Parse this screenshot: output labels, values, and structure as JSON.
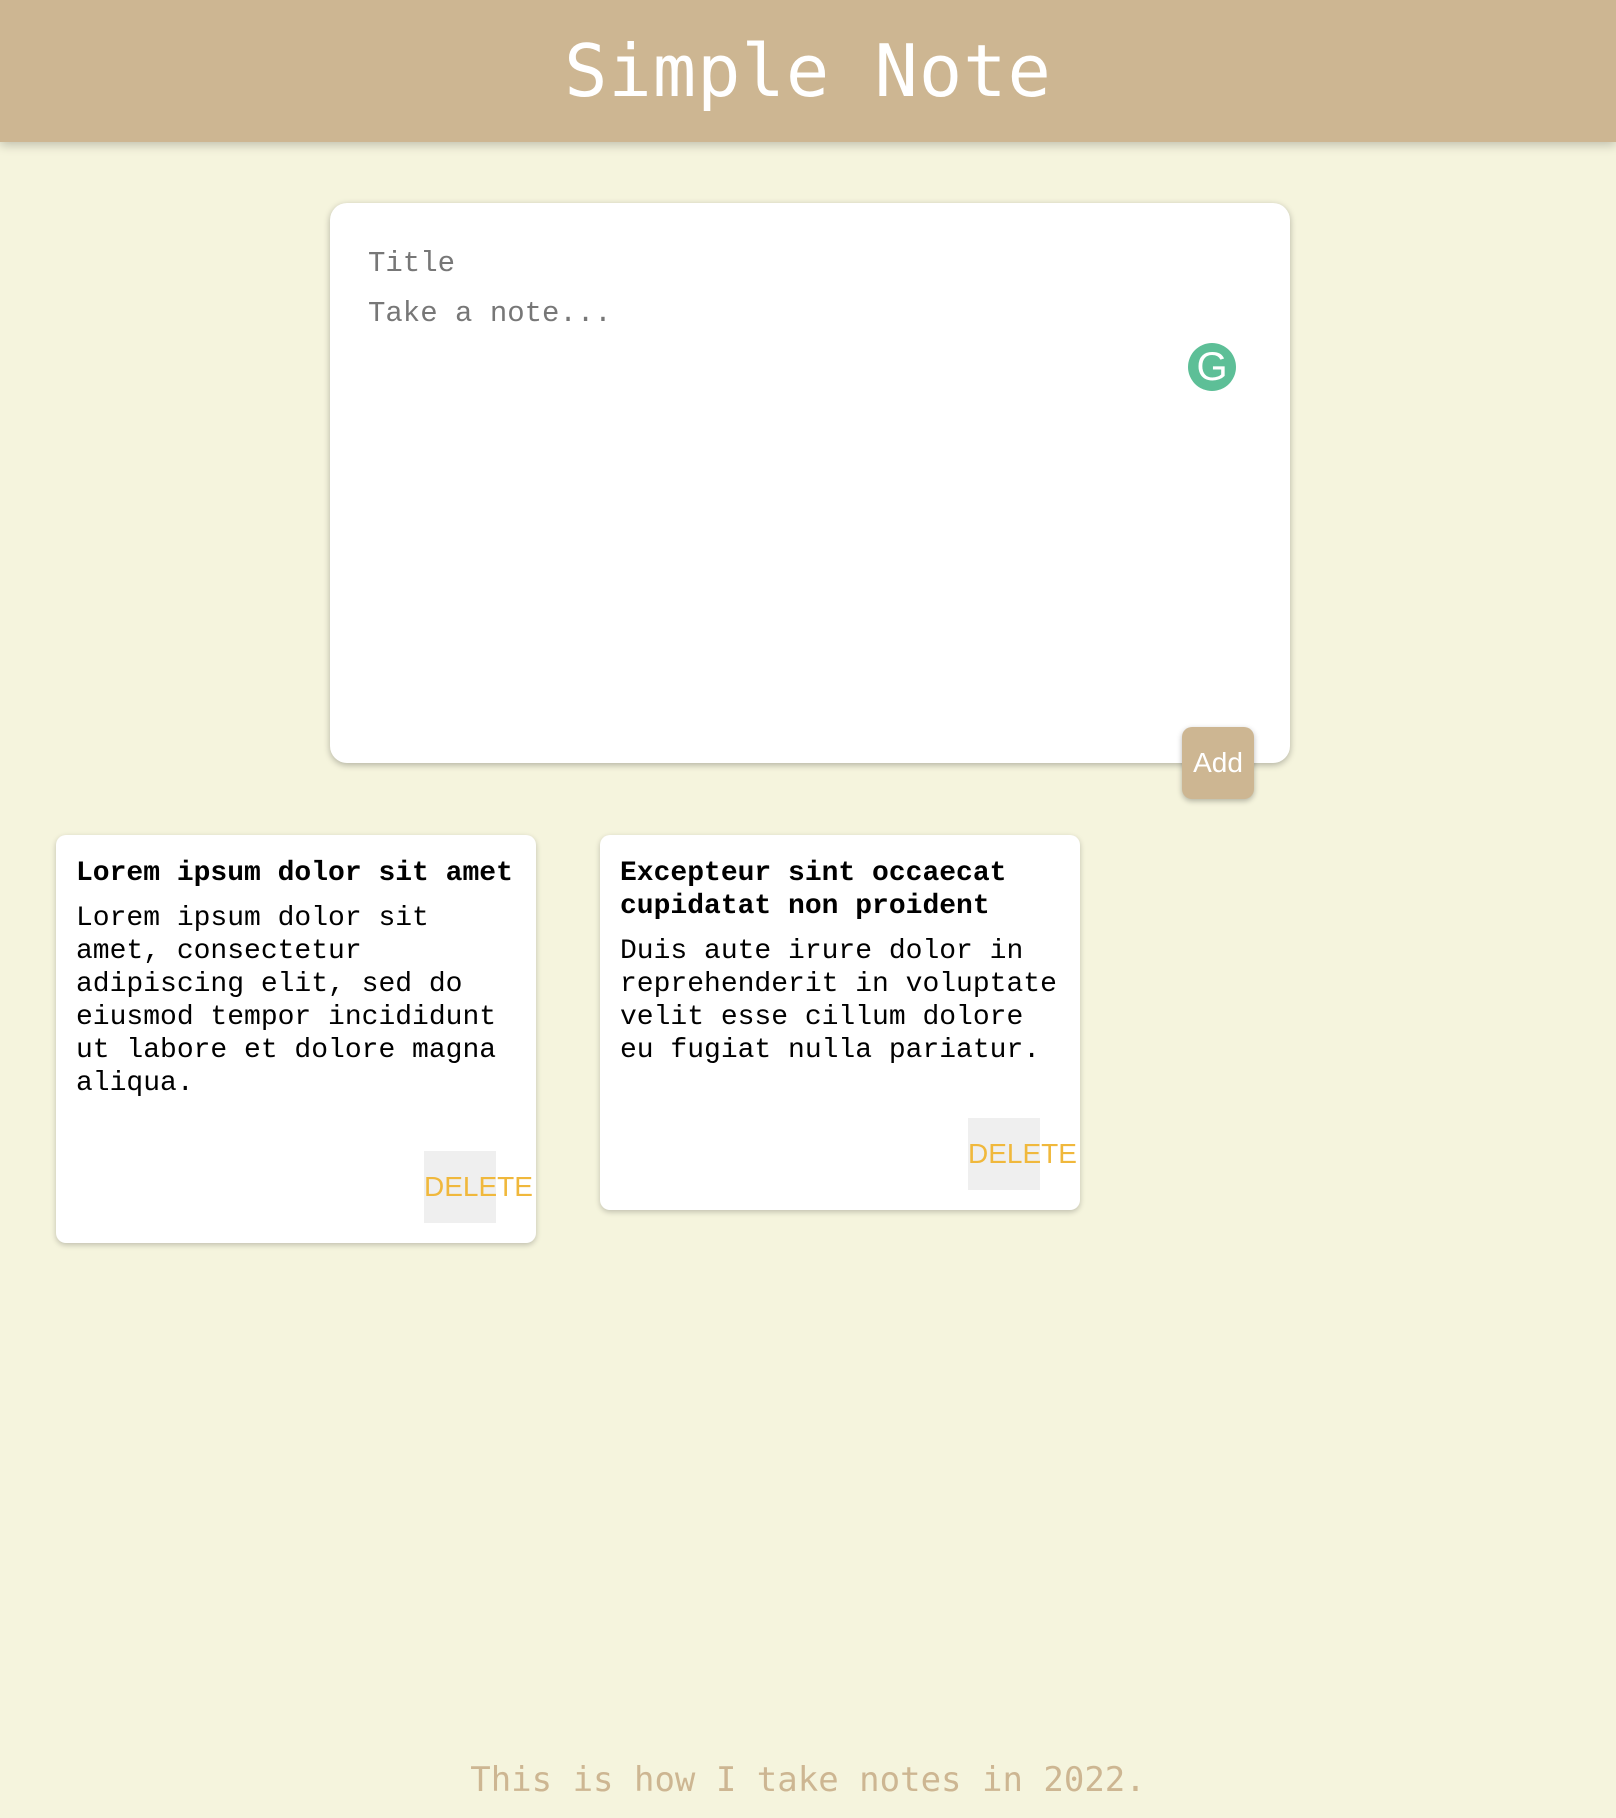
{
  "app": {
    "title": "Simple Note"
  },
  "composer": {
    "title_placeholder": "Title",
    "title_value": "",
    "content_placeholder": "Take a note...",
    "content_value": "",
    "grammarly_glyph": "G",
    "add_label": "Add"
  },
  "notes": [
    {
      "title": "Lorem ipsum dolor sit amet",
      "content": "Lorem ipsum dolor sit amet, consectetur adipiscing elit, sed do eiusmod tempor incididunt ut labore et dolore magna aliqua.",
      "delete_label": "DELETE"
    },
    {
      "title": "Excepteur sint occaecat cupidatat non proident",
      "content": "Duis aute irure dolor in reprehenderit in voluptate velit esse cillum dolore eu fugiat nulla pariatur.",
      "delete_label": "DELETE"
    }
  ],
  "footer": {
    "text": "This is how I take notes in 2022."
  },
  "colors": {
    "background": "#f5f4dd",
    "header": "#cdb692",
    "accent_delete": "#f0b83c",
    "grammarly": "#5dbf97"
  }
}
